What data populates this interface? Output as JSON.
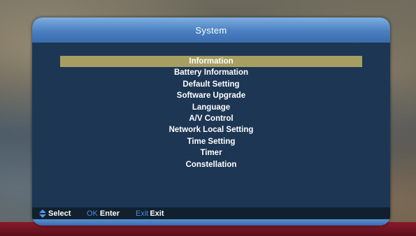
{
  "window": {
    "title": "System"
  },
  "menu": {
    "items": [
      {
        "label": "Information",
        "selected": true
      },
      {
        "label": "Battery Information",
        "selected": false
      },
      {
        "label": "Default Setting",
        "selected": false
      },
      {
        "label": "Software Upgrade",
        "selected": false
      },
      {
        "label": "Language",
        "selected": false
      },
      {
        "label": "A/V Control",
        "selected": false
      },
      {
        "label": "Network Local Setting",
        "selected": false
      },
      {
        "label": "Time Setting",
        "selected": false
      },
      {
        "label": "Timer",
        "selected": false
      },
      {
        "label": "Constellation",
        "selected": false
      }
    ]
  },
  "footer": {
    "select_icon": "up-down-arrow-icon",
    "select_label": "Select",
    "ok_key": "OK",
    "ok_label": "Enter",
    "exit_key": "Exit",
    "exit_label": "Exit"
  },
  "colors": {
    "selection": "#a79f62",
    "key_accent": "#3f8ee6",
    "title_bar": "#4a7fc0",
    "panel": "#1d3654"
  }
}
